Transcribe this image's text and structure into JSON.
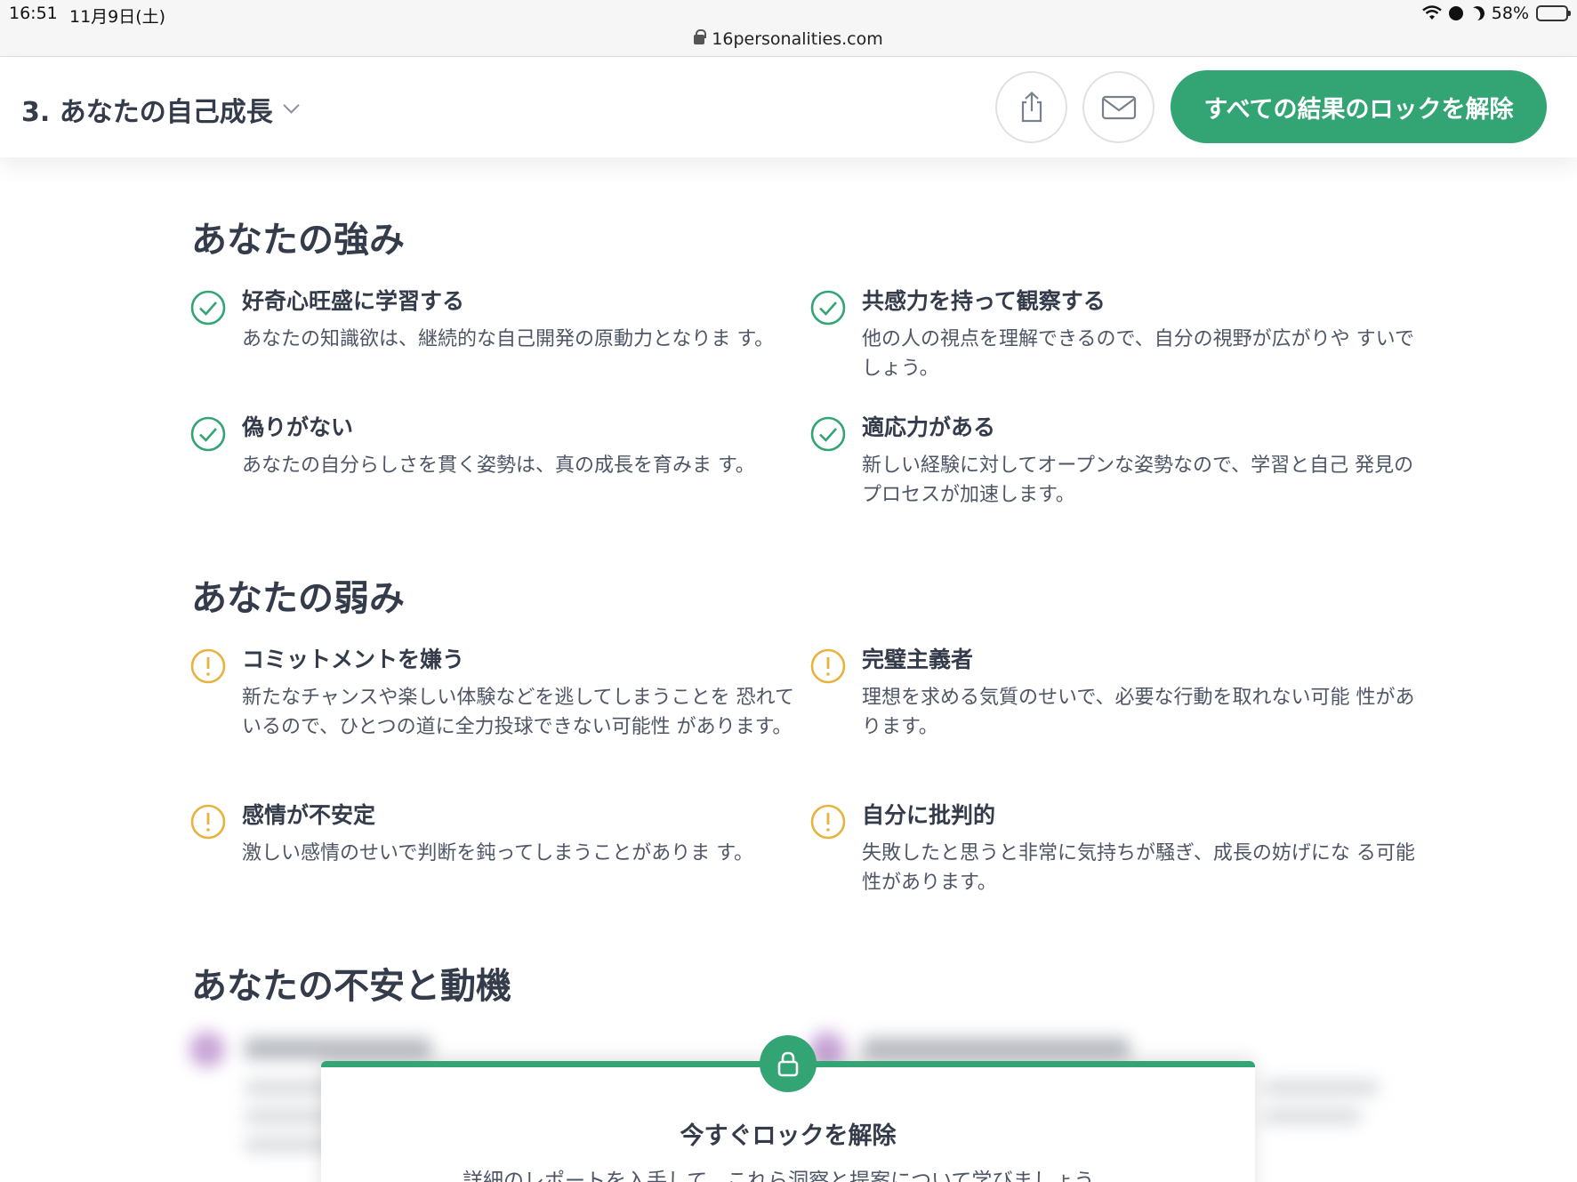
{
  "status_bar": {
    "time": "16:51",
    "date": "11月9日(土)",
    "url": "16personalities.com",
    "battery": "58%",
    "battery_level": 0.58
  },
  "header": {
    "title": "3. あなたの自己成長",
    "unlock_label": "すべての結果のロックを解除"
  },
  "strengths": {
    "title": "あなたの強み",
    "items": [
      {
        "title": "好奇心旺盛に学習する",
        "body": "あなたの知識欲は、継続的な自己開発の原動力となりま す。"
      },
      {
        "title": "共感力を持って観察する",
        "body": "他の人の視点を理解できるので、自分の視野が広がりや すいでしょう。"
      },
      {
        "title": "偽りがない",
        "body": "あなたの自分らしさを貫く姿勢は、真の成長を育みま す。"
      },
      {
        "title": "適応力がある",
        "body": "新しい経験に対してオープンな姿勢なので、学習と自己 発見のプロセスが加速します。"
      }
    ]
  },
  "weaknesses": {
    "title": "あなたの弱み",
    "items": [
      {
        "title": "コミットメントを嫌う",
        "body": "新たなチャンスや楽しい体験などを逃してしまうことを 恐れているので、ひとつの道に全力投球できない可能性 があります。"
      },
      {
        "title": "完璧主義者",
        "body": "理想を求める気質のせいで、必要な行動を取れない可能 性があります。"
      },
      {
        "title": "感情が不安定",
        "body": "激しい感情のせいで判断を鈍ってしまうことがありま す。"
      },
      {
        "title": "自分に批判的",
        "body": "失敗したと思うと非常に気持ちが騒ぎ、成長の妨げにな る可能性があります。"
      }
    ]
  },
  "motivation": {
    "title": "あなたの不安と動機"
  },
  "unlock_card": {
    "title": "今すぐロックを解除",
    "subtitle": "詳細のレポートを入手して、これら洞察と提案について学びましょう。"
  },
  "colors": {
    "accent": "#33a474",
    "warning": "#e8b33c",
    "text": "#343c4b"
  }
}
